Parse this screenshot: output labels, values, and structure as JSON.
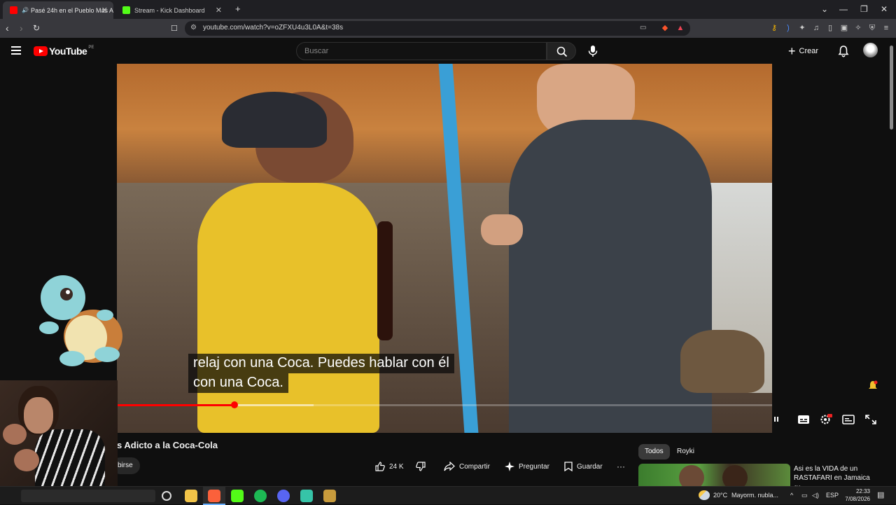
{
  "browser": {
    "tabs": [
      {
        "title": "Pasé 24h en el Pueblo Más Ad",
        "active": true
      },
      {
        "title": "Stream - Kick Dashboard",
        "active": false
      }
    ],
    "new_tab_label": "+",
    "url": "youtube.com/watch?v=oZFXU4u3L0A&t=38s"
  },
  "header": {
    "logo_text": "YouTube",
    "region": "PE",
    "search_placeholder": "Buscar",
    "create_label": "Crear"
  },
  "video": {
    "subtitle_line1": "relaj con una Coca. Puedes hablar con él",
    "subtitle_line2": "con una Coca.",
    "progress": 0.18,
    "buffered": 0.3,
    "title": "s Adicto a la Coca-Cola",
    "subscribe_label": "birse",
    "like_count": "24 K",
    "share_label": "Compartir",
    "ask_label": "Preguntar",
    "save_label": "Guardar",
    "more_label": "···"
  },
  "recommendations": {
    "chips": [
      "Todos",
      "Royki"
    ],
    "first_title": "Asi es la VIDA de un RASTAFARI en Jamaica",
    "first_badge": "JM"
  },
  "taskbar": {
    "weather": "20°C",
    "weather_text": "Mayorm. nubla...",
    "language": "ESP",
    "time": "22:33",
    "date": "7/08/2026"
  },
  "colors": {
    "accent": "#ff0000",
    "background": "#0f0f0f",
    "chip_active": "#3a3a3a"
  }
}
